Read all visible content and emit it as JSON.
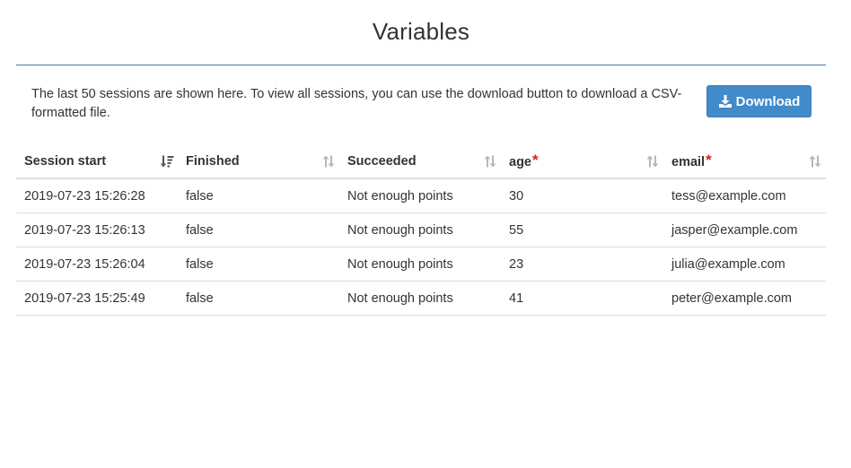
{
  "page": {
    "title": "Variables",
    "intro": "The last 50 sessions are shown here. To view all sessions, you can use the download button to download a CSV-formatted file.",
    "download_label": "Download"
  },
  "table": {
    "columns": [
      {
        "label": "Session start",
        "required": false,
        "sort": "active-desc"
      },
      {
        "label": "Finished",
        "required": false,
        "sort": "none"
      },
      {
        "label": "Succeeded",
        "required": false,
        "sort": "none"
      },
      {
        "label": "age",
        "required": true,
        "required_mark": "*",
        "sort": "none"
      },
      {
        "label": "email",
        "required": true,
        "required_mark": "*",
        "sort": "none"
      }
    ],
    "rows": [
      [
        "2019-07-23 15:26:28",
        "false",
        "Not enough points",
        "30",
        "tess@example.com"
      ],
      [
        "2019-07-23 15:26:13",
        "false",
        "Not enough points",
        "55",
        "jasper@example.com"
      ],
      [
        "2019-07-23 15:26:04",
        "false",
        "Not enough points",
        "23",
        "julia@example.com"
      ],
      [
        "2019-07-23 15:25:49",
        "false",
        "Not enough points",
        "41",
        "peter@example.com"
      ]
    ]
  },
  "colors": {
    "accent": "#428bca",
    "rule": "#4a7aa8",
    "required": "#d9231f"
  }
}
